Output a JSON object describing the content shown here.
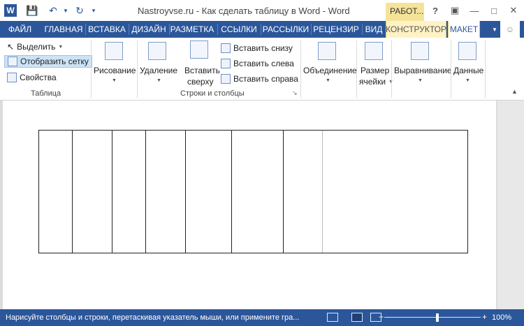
{
  "titlebar": {
    "title": "Nastroyvse.ru - Как сделать таблицу в Word - Word",
    "context_tab": "РАБОТ...",
    "help": "?",
    "app_letter": "W"
  },
  "tabs": [
    {
      "label": "ФАЙЛ"
    },
    {
      "label": "ГЛАВНАЯ"
    },
    {
      "label": "ВСТАВКА"
    },
    {
      "label": "ДИЗАЙН"
    },
    {
      "label": "РАЗМЕТКА"
    },
    {
      "label": "ССЫЛКИ"
    },
    {
      "label": "РАССЫЛКИ"
    },
    {
      "label": "РЕЦЕНЗИР"
    },
    {
      "label": "ВИД"
    },
    {
      "label": "КОНСТРУКТОР"
    },
    {
      "label": "МАКЕТ"
    }
  ],
  "ribbon": {
    "table_group": {
      "select": "Выделить",
      "show_grid": "Отобразить сетку",
      "properties": "Свойства",
      "label": "Таблица"
    },
    "draw": "Рисование",
    "delete": "Удаление",
    "insert_above_1": "Вставить",
    "insert_above_2": "сверху",
    "insert_below": "Вставить снизу",
    "insert_left": "Вставить слева",
    "insert_right": "Вставить справа",
    "rows_cols_label": "Строки и столбцы",
    "merge": "Объединение",
    "cell_size_1": "Размер",
    "cell_size_2": "ячейки",
    "alignment": "Выравнивание",
    "data": "Данные"
  },
  "status": {
    "text": "Нарисуйте столбцы и строки, перетаскивая указатель мыши, или примените гра...",
    "zoom": "100%",
    "zoom_level": 100
  },
  "colors": {
    "accent": "#2b579a",
    "context": "#f5e39a"
  }
}
